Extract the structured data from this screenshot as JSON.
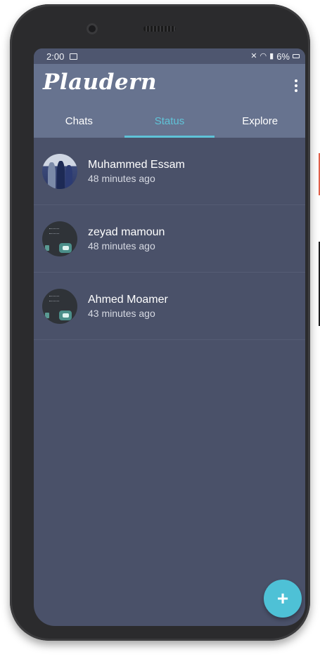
{
  "status_bar": {
    "time": "2:00",
    "battery": "6%",
    "icons": [
      "image-icon",
      "mute-icon",
      "wifi-icon",
      "signal-icon",
      "battery-icon"
    ]
  },
  "app": {
    "title": "Plaudern",
    "menu_icon": "more-vert-icon"
  },
  "tabs": [
    {
      "label": "Chats",
      "active": false
    },
    {
      "label": "Status",
      "active": true
    },
    {
      "label": "Explore",
      "active": false
    }
  ],
  "status_list": [
    {
      "name": "Muhammed Essam",
      "time": "48 minutes ago",
      "avatar": "group-photo"
    },
    {
      "name": "zeyad mamoun",
      "time": "48 minutes ago",
      "avatar": "dark-screenshot"
    },
    {
      "name": "Ahmed Moamer",
      "time": "43 minutes ago",
      "avatar": "dark-screenshot"
    }
  ],
  "fab": {
    "label": "+",
    "icon": "add-icon"
  },
  "colors": {
    "appbar": "#67738f",
    "background": "#4a5169",
    "accent": "#5fc3d8",
    "fab": "#4ec1d6"
  }
}
